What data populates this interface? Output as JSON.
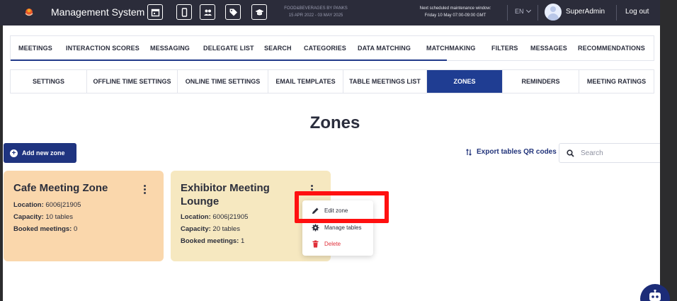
{
  "header": {
    "app_title": "Management System",
    "event_name": "FOOD&BEVERAGES BY PANKS",
    "event_dates": "15 APR 2022 - 03 MAY 2025",
    "maintenance_title": "Next scheduled maintenance window:",
    "maintenance_time": "Friday 10 May 07:00-09:00 GMT",
    "language": "EN",
    "username": "SuperAdmin",
    "logout_label": "Log out",
    "icons": [
      "calendar-icon",
      "mobile-icon",
      "users-icon",
      "tag-icon",
      "graduation-cap-icon"
    ]
  },
  "nav_main": {
    "tabs": [
      "MEETINGS",
      "INTERACTION SCORES",
      "MESSAGING",
      "DELEGATE LIST",
      "SEARCH",
      "CATEGORIES",
      "DATA MATCHING",
      "MATCHMAKING",
      "FILTERS",
      "MESSAGES",
      "RECOMMENDATIONS"
    ],
    "active_group": "MATCHMAKING"
  },
  "nav_sub": {
    "tabs": [
      "SETTINGS",
      "OFFLINE TIME SETTINGS",
      "ONLINE TIME SETTINGS",
      "EMAIL TEMPLATES",
      "TABLE MEETINGS LIST",
      "ZONES",
      "REMINDERS",
      "MEETING RATINGS"
    ],
    "active": "ZONES"
  },
  "page": {
    "title": "Zones",
    "add_button": "Add new zone",
    "export_label": "Export tables QR codes",
    "search_placeholder": "Search"
  },
  "zones": [
    {
      "name": "Cafe Meeting Zone",
      "location_label": "Location:",
      "location": "6006|21905",
      "capacity_label": "Capacity:",
      "capacity": "10 tables",
      "booked_label": "Booked meetings:",
      "booked": "0",
      "color": "#fad7ac"
    },
    {
      "name": "Exhibitor Meeting Lounge",
      "location_label": "Location:",
      "location": "6006|21905",
      "capacity_label": "Capacity:",
      "capacity": "20 tables",
      "booked_label": "Booked meetings:",
      "booked": "1",
      "color": "#f6e8c0"
    }
  ],
  "context_menu": {
    "edit": "Edit zone",
    "manage": "Manage tables",
    "delete": "Delete"
  },
  "colors": {
    "topbar": "#2b2c3a",
    "primary": "#1f3d92",
    "danger": "#e0303a",
    "highlight": "#ff1010"
  }
}
